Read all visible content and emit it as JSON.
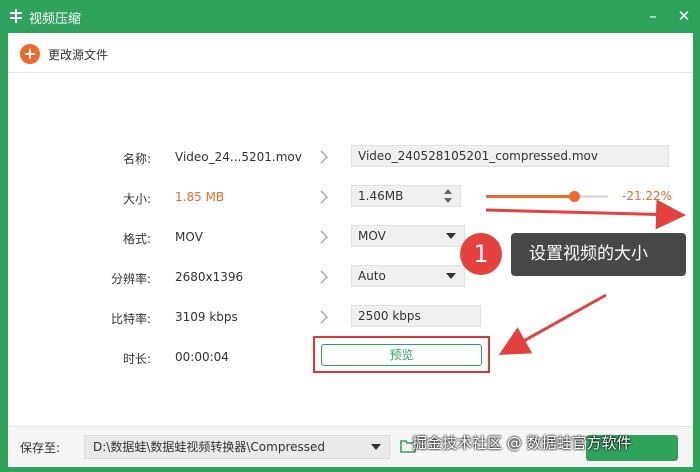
{
  "window": {
    "title": "视频压缩"
  },
  "toolbar": {
    "change_source_label": "更改源文件"
  },
  "rows": {
    "name": {
      "label": "名称:",
      "source": "Video_24...5201.mov",
      "output": "Video_240528105201_compressed.mov"
    },
    "size": {
      "label": "大小:",
      "source": "1.85 MB",
      "output": "1.46MB",
      "slider_percent": 0.72,
      "change": "-21.22%"
    },
    "format": {
      "label": "格式:",
      "source": "MOV",
      "output": "MOV"
    },
    "resolution": {
      "label": "分辨率:",
      "source": "2680x1396",
      "output": "Auto"
    },
    "bitrate": {
      "label": "比特率:",
      "source": "3109 kbps",
      "output": "2500 kbps"
    },
    "duration": {
      "label": "时长:",
      "source": "00:00:04"
    }
  },
  "preview_label": "预览",
  "annotation": {
    "number": "1",
    "text": "设置视频的大小"
  },
  "footer": {
    "save_label": "保存至:",
    "path": "D:\\数据蛙\\数据蛙视频转换器\\Compressed"
  },
  "watermark": "掘金技术社区 @ 数据蛙官方软件",
  "colors": {
    "brand": "#2fa35e",
    "accent": "#f0682e",
    "annotation_red": "#e5413e"
  }
}
